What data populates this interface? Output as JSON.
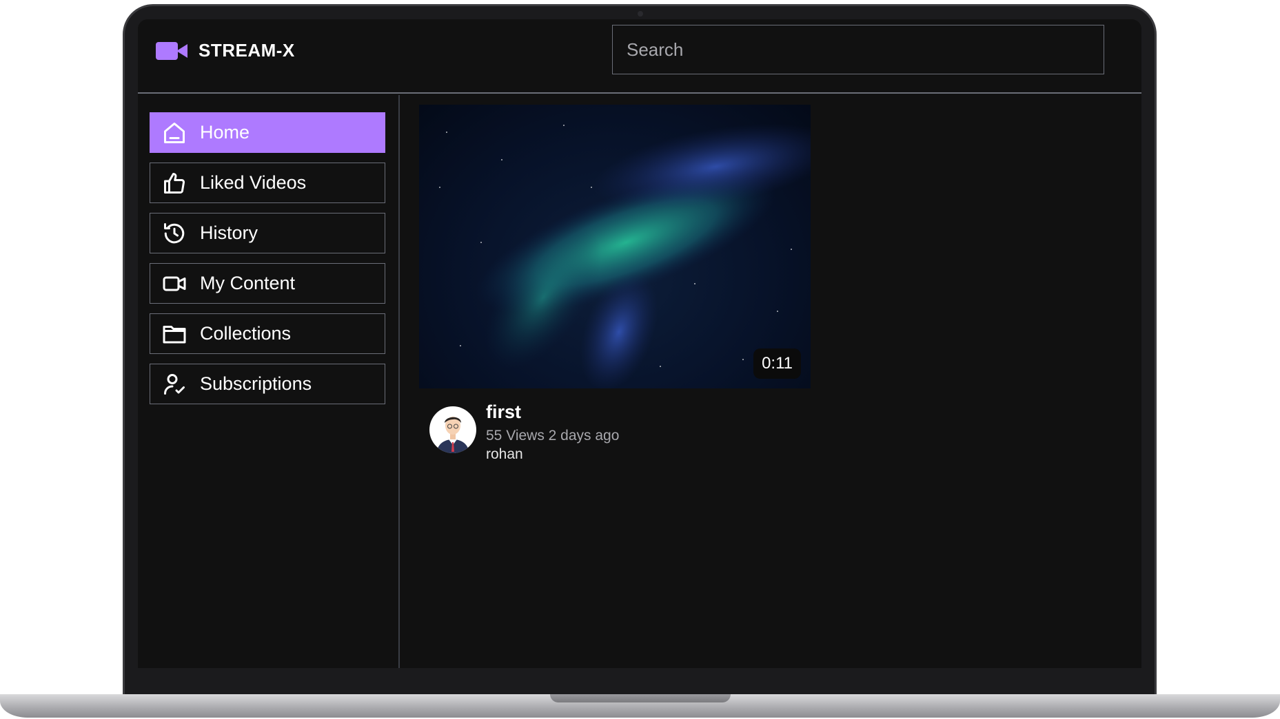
{
  "app": {
    "name": "STREAM-X"
  },
  "header": {
    "search_placeholder": "Search"
  },
  "sidebar": {
    "items": [
      {
        "label": "Home",
        "icon": "home-icon",
        "active": true
      },
      {
        "label": "Liked Videos",
        "icon": "thumbs-up-icon",
        "active": false
      },
      {
        "label": "History",
        "icon": "history-icon",
        "active": false
      },
      {
        "label": "My Content",
        "icon": "video-camera-icon",
        "active": false
      },
      {
        "label": "Collections",
        "icon": "folder-icon",
        "active": false
      },
      {
        "label": "Subscriptions",
        "icon": "user-check-icon",
        "active": false
      }
    ]
  },
  "videos": [
    {
      "title": "first",
      "views": "55 Views",
      "age": "2 days ago",
      "stats": "55 Views 2 days ago",
      "owner": "rohan",
      "duration": "0:11"
    }
  ],
  "colors": {
    "accent": "#ae7aff",
    "background": "#111111",
    "border": "#6b6e78"
  }
}
